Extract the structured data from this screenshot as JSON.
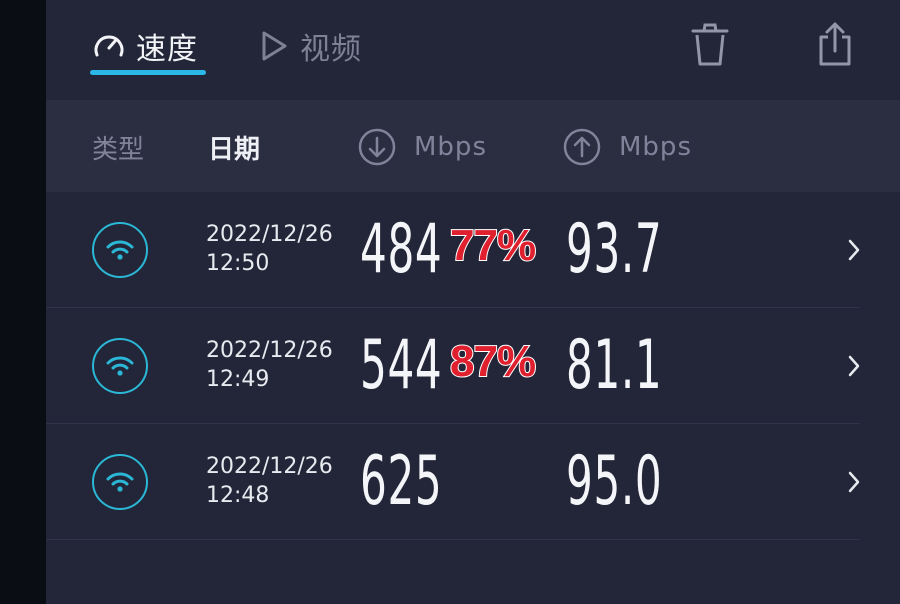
{
  "tabs": [
    {
      "label": "速度",
      "icon": "speedometer-icon",
      "active": true
    },
    {
      "label": "视频",
      "icon": "play-icon",
      "active": false
    }
  ],
  "toolbar": {
    "delete_icon": "trash-icon",
    "share_icon": "share-icon"
  },
  "columns": {
    "type": "类型",
    "date": "日期",
    "download_unit": "Mbps",
    "upload_unit": "Mbps"
  },
  "rows": [
    {
      "connection": "wifi",
      "date": "2022/12/26",
      "time": "12:50",
      "download": "484",
      "ratio": "77%",
      "upload": "93.7"
    },
    {
      "connection": "wifi",
      "date": "2022/12/26",
      "time": "12:49",
      "download": "544",
      "ratio": "87%",
      "upload": "81.1"
    },
    {
      "connection": "wifi",
      "date": "2022/12/26",
      "time": "12:48",
      "download": "625",
      "ratio": "",
      "upload": "95.0"
    }
  ],
  "colors": {
    "accent": "#2ab8e6",
    "wifi_ring": "#2bb8d6",
    "highlight_red": "#e0202e",
    "background": "#232638",
    "header_band": "#2b2e41"
  }
}
